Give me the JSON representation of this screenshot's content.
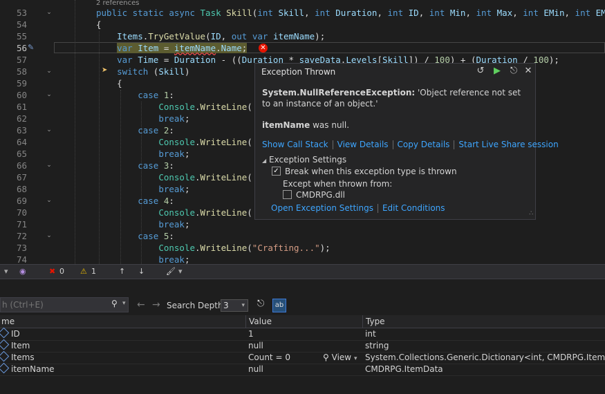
{
  "editor": {
    "references": "2 references",
    "lines": [
      {
        "num": "53",
        "text": "public static async Task Skill(int Skill, int Duration, int ID, int Min, int Max, int EMin, int EMax"
      },
      {
        "num": "54",
        "text": "{"
      },
      {
        "num": "55",
        "text": "    Items.TryGetValue(ID, out var itemName);"
      },
      {
        "num": "56",
        "text": "    var Item = itemName.Name;"
      },
      {
        "num": "57",
        "text": "    var Time = Duration - ((Duration * saveData.Levels[Skill]) / 100) + (Duration / 100);"
      },
      {
        "num": "58",
        "text": "    switch (Skill)"
      },
      {
        "num": "59",
        "text": "    {"
      },
      {
        "num": "60",
        "text": "        case 1:"
      },
      {
        "num": "61",
        "text": "            Console.WriteLine("
      },
      {
        "num": "62",
        "text": "            break;"
      },
      {
        "num": "63",
        "text": "        case 2:"
      },
      {
        "num": "64",
        "text": "            Console.WriteLine("
      },
      {
        "num": "65",
        "text": "            break;"
      },
      {
        "num": "66",
        "text": "        case 3:"
      },
      {
        "num": "67",
        "text": "            Console.WriteLine("
      },
      {
        "num": "68",
        "text": "            break;"
      },
      {
        "num": "69",
        "text": "        case 4:"
      },
      {
        "num": "70",
        "text": "            Console.WriteLine("
      },
      {
        "num": "71",
        "text": "            break;"
      },
      {
        "num": "72",
        "text": "        case 5:"
      },
      {
        "num": "73",
        "text": "            Console.WriteLine(\"Crafting...\");"
      },
      {
        "num": "74",
        "text": "            break;"
      }
    ]
  },
  "exception_popup": {
    "title": "Exception Thrown",
    "exception_type": "System.NullReferenceException:",
    "exception_message": "'Object reference not set to an instance of an object.'",
    "null_var": "itemName",
    "null_suffix": "was null.",
    "links": [
      "Show Call Stack",
      "View Details",
      "Copy Details",
      "Start Live Share session"
    ],
    "settings_header": "Exception Settings",
    "break_option": "Break when this exception type is thrown",
    "except_label": "Except when thrown from:",
    "module": "CMDRPG.dll",
    "bottom_links": [
      "Open Exception Settings",
      "Edit Conditions"
    ]
  },
  "toolbar": {
    "errors": "0",
    "warnings": "1"
  },
  "locals": {
    "search_placeholder": "h (Ctrl+E)",
    "search_depth_label": "Search Depth:",
    "search_depth_value": "3",
    "columns": [
      "me",
      "Value",
      "Type"
    ],
    "rows": [
      {
        "name": "ID",
        "value": "1",
        "type": "int"
      },
      {
        "name": "Item",
        "value": "null",
        "type": "string"
      },
      {
        "name": "Items",
        "value": "Count = 0",
        "view": "View",
        "type": "System.Collections.Generic.Dictionary<int, CMDRPG.ItemData>"
      },
      {
        "name": "itemName",
        "value": "null",
        "type": "CMDRPG.ItemData"
      }
    ]
  }
}
